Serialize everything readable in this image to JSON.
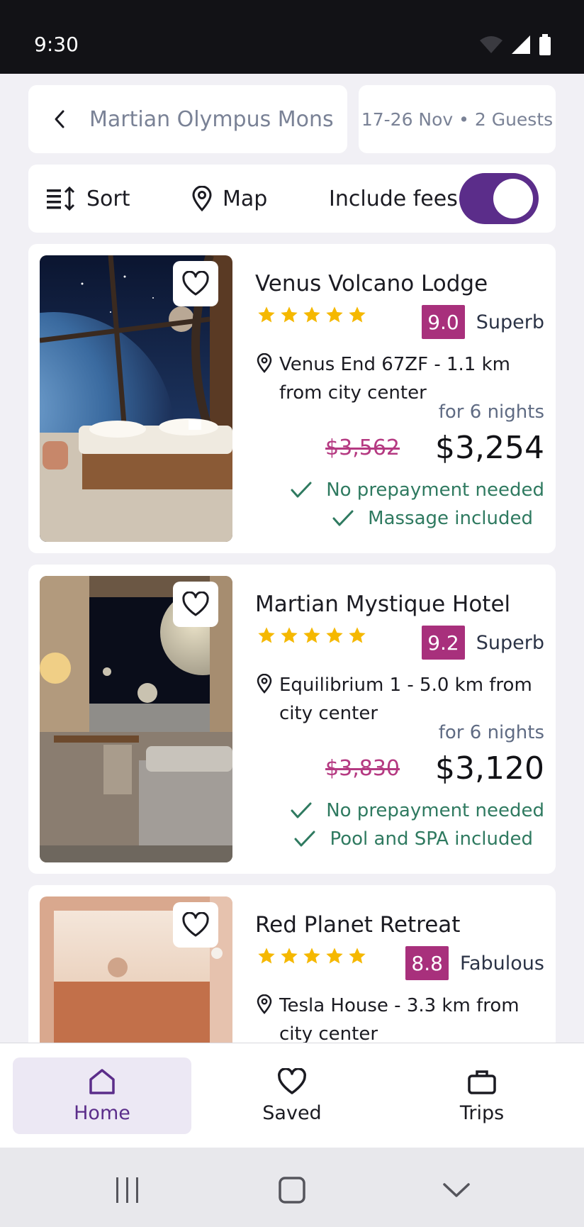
{
  "status_bar": {
    "time": "9:30"
  },
  "search": {
    "destination": "Martian Olympus Mons",
    "dates_guests": "17-26 Nov • 2 Guests"
  },
  "toolbar": {
    "sort_label": "Sort",
    "map_label": "Map",
    "fees_label": "Include fees",
    "fees_on": true
  },
  "hotels": [
    {
      "name": "Venus Volcano Lodge",
      "stars": 5,
      "score": "9.0",
      "score_label": "Superb",
      "address": "Venus End 67ZF - 1.1 km from city center",
      "nights": "for 6  nights",
      "old_price": "$3,562",
      "price": "$3,254",
      "perks": [
        "No prepayment needed",
        "Massage included"
      ]
    },
    {
      "name": "Martian Mystique Hotel",
      "stars": 5,
      "score": "9.2",
      "score_label": "Superb",
      "address": "Equilibrium 1 - 5.0 km from city center",
      "nights": "for 6  nights",
      "old_price": "$3,830",
      "price": "$3,120",
      "perks": [
        "No prepayment needed",
        "Pool and SPA included"
      ]
    },
    {
      "name": "Red Planet Retreat",
      "stars": 5,
      "score": "8.8",
      "score_label": "Fabulous",
      "address": "Tesla House - 3.3 km from city center"
    }
  ],
  "bottom_nav": {
    "home": "Home",
    "saved": "Saved",
    "trips": "Trips",
    "active": "home"
  },
  "colors": {
    "accent": "#5b2d8a",
    "score_bg": "#a8307c",
    "perk": "#2f7a60",
    "star": "#f5b800"
  }
}
